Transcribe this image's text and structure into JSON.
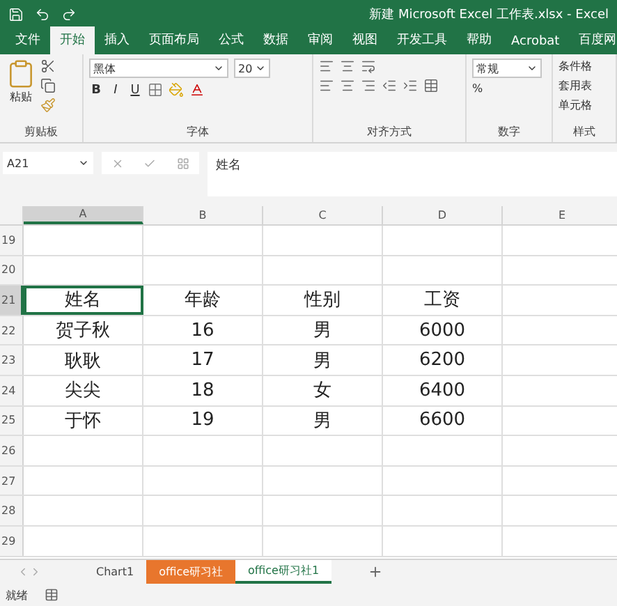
{
  "title_bar": {
    "title": "新建 Microsoft Excel 工作表.xlsx - Excel"
  },
  "ribbon_tabs": [
    {
      "label": "文件",
      "selected": false
    },
    {
      "label": "开始",
      "selected": true
    },
    {
      "label": "插入",
      "selected": false
    },
    {
      "label": "页面布局",
      "selected": false
    },
    {
      "label": "公式",
      "selected": false
    },
    {
      "label": "数据",
      "selected": false
    },
    {
      "label": "审阅",
      "selected": false
    },
    {
      "label": "视图",
      "selected": false
    },
    {
      "label": "开发工具",
      "selected": false
    },
    {
      "label": "帮助",
      "selected": false
    },
    {
      "label": "Acrobat",
      "selected": false
    },
    {
      "label": "百度网",
      "selected": false
    }
  ],
  "ribbon": {
    "paste_label": "粘贴",
    "font_name": "黑体",
    "font_size": "20",
    "format_buttons": [
      "B",
      "I",
      "U"
    ],
    "number_format": "常规",
    "percent": "%",
    "style_items": [
      "条件格",
      "套用表",
      "单元格"
    ],
    "groups": [
      "剪贴板",
      "字体",
      "对齐方式",
      "数字",
      "样式"
    ]
  },
  "formula_bar": {
    "name_box": "A21",
    "formula": "姓名"
  },
  "columns": [
    {
      "label": "A",
      "selected": true
    },
    {
      "label": "B",
      "selected": false
    },
    {
      "label": "C",
      "selected": false
    },
    {
      "label": "D",
      "selected": false
    },
    {
      "label": "E",
      "selected": false
    }
  ],
  "rows": [
    {
      "number": "19",
      "selected": false,
      "cells": []
    },
    {
      "number": "20",
      "selected": false,
      "cells": []
    },
    {
      "number": "21",
      "selected": true,
      "cells": [
        "姓名",
        "年龄",
        "性别",
        "工资"
      ]
    },
    {
      "number": "22",
      "selected": false,
      "cells": [
        "贺子秋",
        "16",
        "男",
        "6000"
      ]
    },
    {
      "number": "23",
      "selected": false,
      "cells": [
        "耿耿",
        "17",
        "男",
        "6200"
      ]
    },
    {
      "number": "24",
      "selected": false,
      "cells": [
        "尖尖",
        "18",
        "女",
        "6400"
      ]
    },
    {
      "number": "25",
      "selected": false,
      "cells": [
        "于怀",
        "19",
        "男",
        "6600"
      ]
    },
    {
      "number": "26",
      "selected": false,
      "cells": []
    },
    {
      "number": "27",
      "selected": false,
      "cells": []
    },
    {
      "number": "28",
      "selected": false,
      "cells": []
    },
    {
      "number": "29",
      "selected": false,
      "cells": []
    }
  ],
  "sheet_tabs": [
    {
      "label": "Chart1",
      "selected": false
    },
    {
      "label": "office研习社",
      "selected": false,
      "color": "#e8762d"
    },
    {
      "label": "office研习社1",
      "selected": true
    }
  ],
  "status_bar": {
    "text": "就绪"
  }
}
